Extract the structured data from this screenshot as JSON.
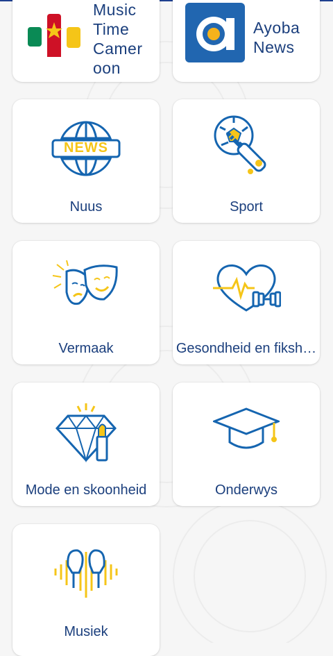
{
  "channels": [
    {
      "title": "Music\nTime\nCamer\noon",
      "icon": "cameroon-flag-bars-icon"
    },
    {
      "title": "Ayoba\nNews",
      "icon": "ayoba-logo-icon"
    }
  ],
  "categories": [
    {
      "label": "Nuus",
      "icon": "news-globe-icon"
    },
    {
      "label": "Sport",
      "icon": "soccer-ball-cricket-bat-icon"
    },
    {
      "label": "Vermaak",
      "icon": "theater-masks-icon"
    },
    {
      "label": "Gesondheid en fiksh…",
      "icon": "heart-dumbbell-icon"
    },
    {
      "label": "Mode en skoonheid",
      "icon": "diamond-lipstick-icon"
    },
    {
      "label": "Onderwys",
      "icon": "graduation-cap-icon"
    },
    {
      "label": "Musiek",
      "icon": "headphones-soundwave-icon"
    }
  ],
  "news_badge_text": "NEWS",
  "colors": {
    "primary": "#1b3f7d",
    "icon_blue": "#1565b0",
    "accent_yellow": "#f5c518",
    "ayoba_blue": "#2166b0"
  }
}
